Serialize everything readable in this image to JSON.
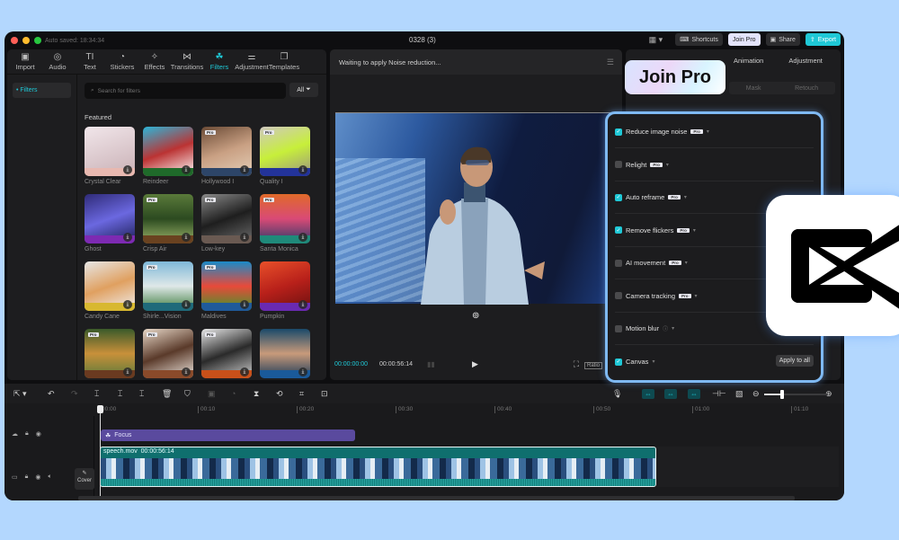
{
  "window": {
    "autosave": "Auto saved: 18:34:34",
    "project_title": "0328 (3)",
    "buttons": {
      "shortcuts": "Shortcuts",
      "join_pro": "Join Pro",
      "share": "Share",
      "export": "Export"
    }
  },
  "toolbar": [
    {
      "label": "Import",
      "icon": "import-icon",
      "glyph": "▣"
    },
    {
      "label": "Audio",
      "icon": "audio-icon",
      "glyph": "◎"
    },
    {
      "label": "Text",
      "icon": "text-icon",
      "glyph": "TI"
    },
    {
      "label": "Stickers",
      "icon": "sticker-icon",
      "glyph": "◔"
    },
    {
      "label": "Effects",
      "icon": "effects-icon",
      "glyph": "✧"
    },
    {
      "label": "Transitions",
      "icon": "transitions-icon",
      "glyph": "⋈"
    },
    {
      "label": "Filters",
      "icon": "filters-icon",
      "glyph": "☘",
      "active": true
    },
    {
      "label": "Adjustment",
      "icon": "adjustment-icon",
      "glyph": "⚌"
    },
    {
      "label": "Templates",
      "icon": "templates-icon",
      "glyph": "❐"
    }
  ],
  "filters_panel": {
    "side_item": "• Filters",
    "search_placeholder": "Search for filters",
    "all_label": "All",
    "section_title": "Featured",
    "items": [
      {
        "label": "Crystal Clear",
        "pro": false,
        "bg": "linear-gradient(160deg,#f1e6ea,#c9b0b5)",
        "band": "#e8b8b0"
      },
      {
        "label": "Reindeer",
        "pro": false,
        "bg": "linear-gradient(160deg,#2db5d8,#b33,#fff)",
        "band": "#1f6a2a"
      },
      {
        "label": "Hollywood I",
        "pro": true,
        "bg": "linear-gradient(160deg,#6b4b36,#c9a083,#e4cfb8)",
        "band": "#2d4568"
      },
      {
        "label": "Quality I",
        "pro": true,
        "bg": "linear-gradient(160deg,#cfc8bf,#c7ef3a,#9b9186)",
        "band": "#23339a"
      },
      {
        "label": "Ghost",
        "pro": false,
        "bg": "linear-gradient(160deg,#2f2b78,#6b68e0,#1a1b50)",
        "band": "#7d2ab2"
      },
      {
        "label": "Crisp Air",
        "pro": true,
        "bg": "linear-gradient(180deg,#5a7a3a,#2c4a20,#9cb56a)",
        "band": "#6a4220"
      },
      {
        "label": "Low-key",
        "pro": true,
        "bg": "linear-gradient(160deg,#8a8a8a,#1e1e1e,#6d6d6d)",
        "band": "#6a5a52"
      },
      {
        "label": "Santa Monica",
        "pro": true,
        "bg": "linear-gradient(180deg,#e06a2a,#d94a76,#2a3a6a)",
        "band": "#1f8a7a"
      },
      {
        "label": "Candy Cane",
        "pro": false,
        "bg": "linear-gradient(160deg,#e6e6e6,#e0a060,#f0f0f0)",
        "band": "#d8b830"
      },
      {
        "label": "Shirle...Vision",
        "pro": true,
        "bg": "linear-gradient(180deg,#7fb8d8,#dfe8e8,#3a7a3a)",
        "band": "#1f6a7a"
      },
      {
        "label": "Maldives",
        "pro": true,
        "bg": "linear-gradient(180deg,#1a8ac8,#e84a3a,#3a9a2a)",
        "band": "#1f5a9a"
      },
      {
        "label": "Pumpkin",
        "pro": false,
        "bg": "linear-gradient(160deg,#e8502a,#b8201a,#6a1010)",
        "band": "#6a2ab2"
      },
      {
        "label": "",
        "pro": true,
        "bg": "linear-gradient(180deg,#3a5a2a,#c8903a,#5a7a3a)",
        "band": "#6a3a20"
      },
      {
        "label": "",
        "pro": true,
        "bg": "linear-gradient(160deg,#e8d8c8,#5a3a2a,#f0e8e0)",
        "band": "#8a4a2a"
      },
      {
        "label": "",
        "pro": true,
        "bg": "linear-gradient(160deg,#e8e8e8,#2a2a2a,#d0d0d0)",
        "band": "#c8501a"
      },
      {
        "label": "",
        "pro": false,
        "bg": "linear-gradient(180deg,#1a4a6a,#c89a7a,#1a3a5a)",
        "band": "#1a5a9a"
      }
    ]
  },
  "player": {
    "status": "Waiting to apply Noise reduction...",
    "current_time": "00:00:00:00",
    "total_time": "00:00:56:14",
    "ratio_label": "Ratio"
  },
  "right_panel": {
    "tabs": [
      "Animation",
      "Adjustment"
    ],
    "subtabs": [
      "Mask",
      "Retouch"
    ],
    "join_pro_banner": "Join Pro"
  },
  "enhance_options": [
    {
      "label": "Reduce image noise",
      "checked": true,
      "pro": true
    },
    {
      "label": "Relight",
      "checked": false,
      "pro": true
    },
    {
      "label": "Auto reframe",
      "checked": true,
      "pro": true
    },
    {
      "label": "Remove flickers",
      "checked": true,
      "pro": true
    },
    {
      "label": "AI movement",
      "checked": false,
      "pro": true
    },
    {
      "label": "Camera tracking",
      "checked": false,
      "pro": true
    },
    {
      "label": "Motion blur",
      "checked": false,
      "pro": false,
      "help": true
    },
    {
      "label": "Canvas",
      "checked": true,
      "pro": false
    }
  ],
  "pro_badge": "Pro",
  "apply_all": "Apply to all",
  "timeline": {
    "ruler": [
      "00:00",
      "00:10",
      "00:20",
      "00:30",
      "00:40",
      "00:50",
      "01:00",
      "01:10"
    ],
    "focus_clip": "Focus",
    "video_clip_name": "speech.mov",
    "video_clip_duration": "00:00:56:14",
    "cover_label": "Cover",
    "zoom_level": 0.25
  },
  "colors": {
    "accent": "#1fc8d6",
    "focus": "#5a4a9e",
    "clip": "#0f6f6e",
    "popup_border": "#7fb9f2"
  }
}
